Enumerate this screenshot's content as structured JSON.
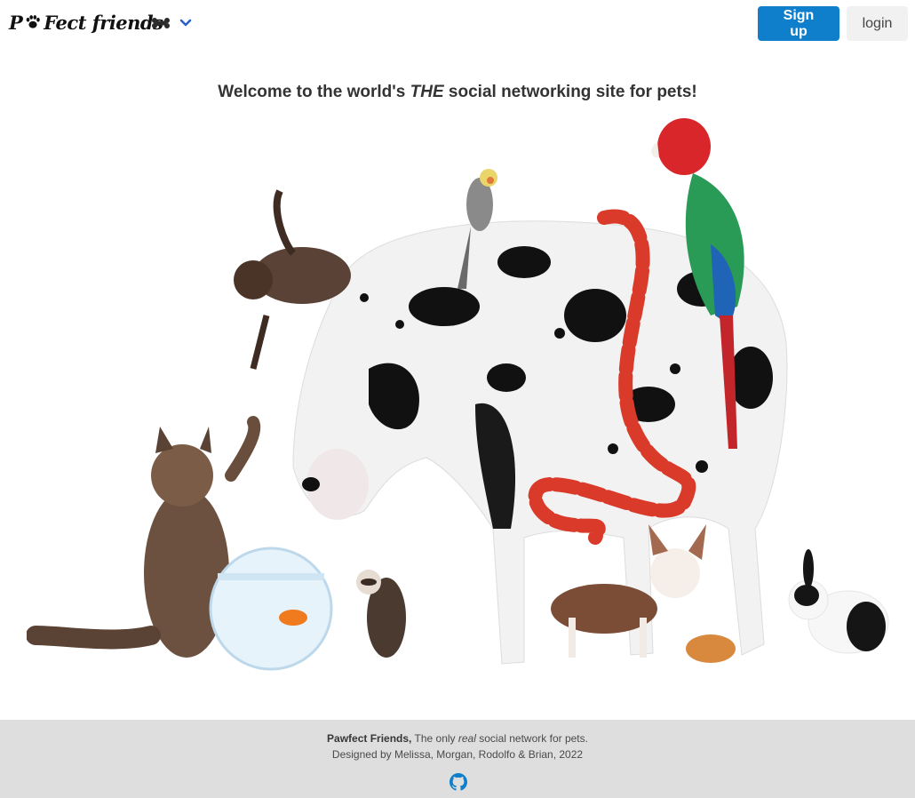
{
  "brand": {
    "name_part1": "P",
    "name_part2": "Fect friends"
  },
  "nav": {
    "menu_icon": "bone-icon",
    "dropdown_icon": "chevron-down-icon",
    "signup_label": "Sign up",
    "login_label": "login"
  },
  "hero": {
    "title_before": "Welcome to the world's ",
    "title_emph": "THE",
    "title_after": " social networking site for pets!",
    "image_subjects": [
      "kitten",
      "cockatiel",
      "macaw",
      "great-dane",
      "milk-snake",
      "maine-coon-cat",
      "fishbowl",
      "clownfish",
      "ferret",
      "chihuahua",
      "hamster",
      "rabbit"
    ]
  },
  "footer": {
    "brand": "Pawfect Friends,",
    "tagline_before": " The only ",
    "tagline_emph": "real",
    "tagline_after": " social network for pets.",
    "credits": "Designed by Melissa, Morgan, Rodolfo & Brian, 2022",
    "github_icon": "github-icon"
  },
  "colors": {
    "primary": "#0f7fcb",
    "footer_bg": "#dedede",
    "chevron": "#2a62c9"
  }
}
